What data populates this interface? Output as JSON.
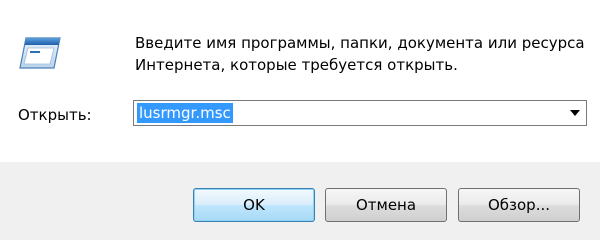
{
  "dialog": {
    "description_line1": "Введите имя программы, папки, документа или ресурса",
    "description_line2": "Интернета, которые требуется открыть.",
    "open_label": "Открыть:",
    "command_value": "lusrmgr.msc",
    "buttons": {
      "ok_label": "OK",
      "cancel_label": "Отмена",
      "browse_label": "Обзор..."
    },
    "icons": {
      "app": "run-dialog-icon",
      "dropdown": "chevron-down-icon"
    },
    "colors": {
      "selection": "#3399ff",
      "window_bg": "#ffffff",
      "footer_bg": "#f0f0f0"
    }
  }
}
